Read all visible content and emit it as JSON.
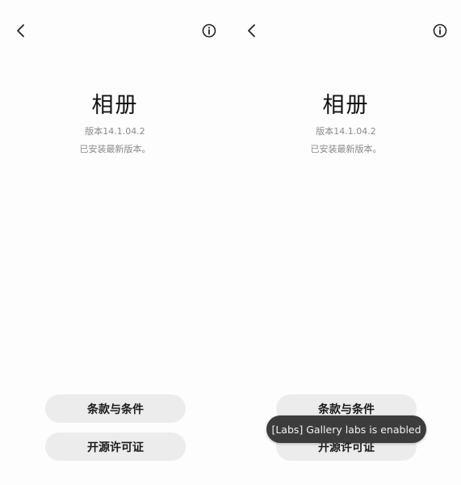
{
  "screens": [
    {
      "app_name": "相册",
      "version": "版本14.1.04.2",
      "status": "已安装最新版本。",
      "buttons": {
        "terms": "条款与条件",
        "license": "开源许可证"
      }
    },
    {
      "app_name": "相册",
      "version": "版本14.1.04.2",
      "status": "已安装最新版本。",
      "buttons": {
        "terms": "条款与条件",
        "license": "开源许可证"
      },
      "toast": "[Labs] Gallery labs is enabled"
    }
  ],
  "icons": {
    "back": "chevron-left-icon",
    "info": "info-circle-icon"
  },
  "colors": {
    "background": "#fdfdfd",
    "button_bg": "#ececec",
    "toast_bg": "#3c3c3c",
    "secondary_text": "#8a8a8a"
  }
}
